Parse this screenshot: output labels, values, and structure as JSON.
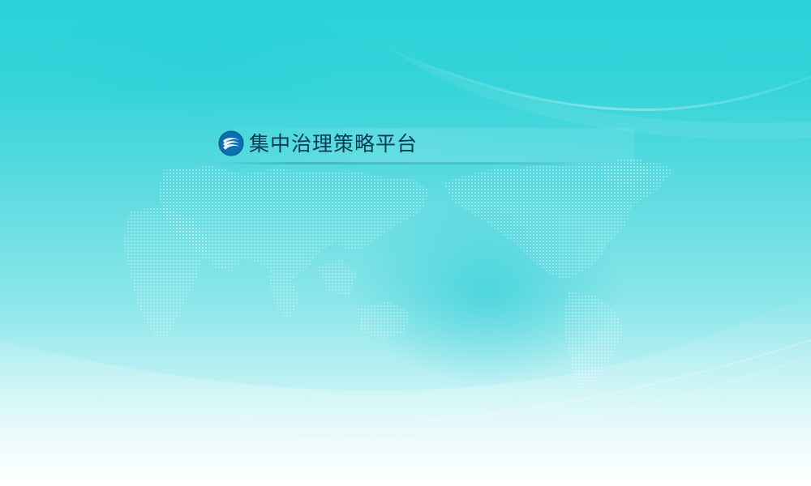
{
  "header": {
    "logo_icon": "china-mobile-logo-icon",
    "title": "集中治理策略平台"
  },
  "colors": {
    "background_top": "#29d3d8",
    "background_bottom": "#ffffff",
    "title_text": "#0a3d52",
    "logo_blue": "#0b6fb0"
  }
}
